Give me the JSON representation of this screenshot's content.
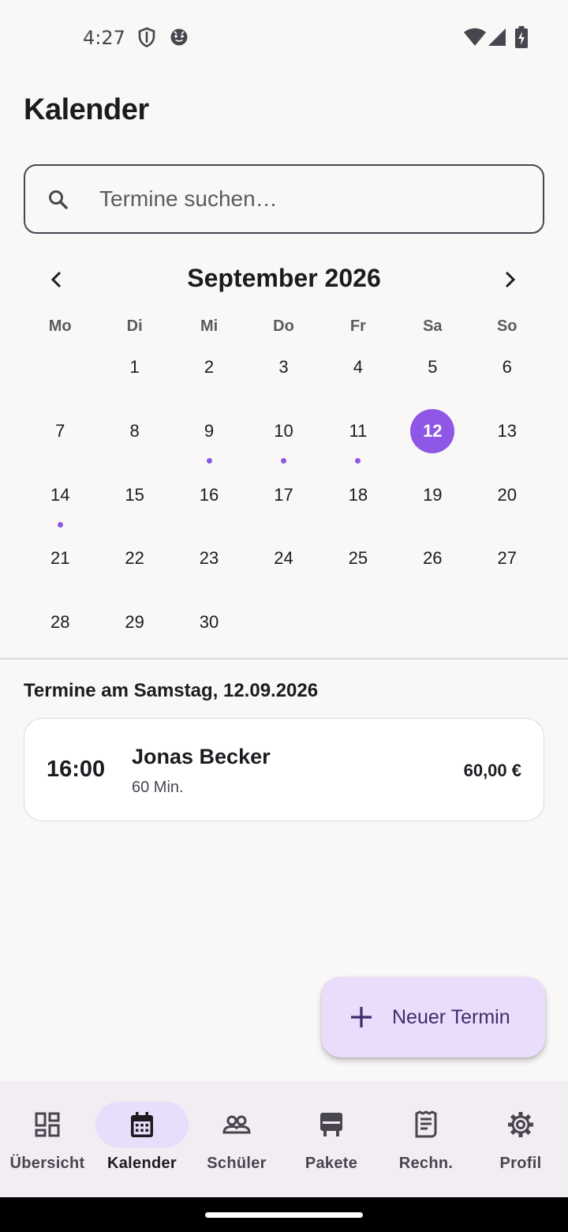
{
  "status_bar": {
    "time": "4:27"
  },
  "header": {
    "title": "Kalender"
  },
  "search": {
    "placeholder": "Termine suchen…",
    "value": ""
  },
  "calendar": {
    "month_label": "September 2026",
    "weekdays": [
      "Mo",
      "Di",
      "Mi",
      "Do",
      "Fr",
      "Sa",
      "So"
    ],
    "weeks": [
      [
        {
          "day": ""
        },
        {
          "day": "1"
        },
        {
          "day": "2"
        },
        {
          "day": "3"
        },
        {
          "day": "4"
        },
        {
          "day": "5"
        },
        {
          "day": "6"
        }
      ],
      [
        {
          "day": "7"
        },
        {
          "day": "8"
        },
        {
          "day": "9",
          "has_event": true
        },
        {
          "day": "10",
          "has_event": true
        },
        {
          "day": "11",
          "has_event": true
        },
        {
          "day": "12",
          "selected": true
        },
        {
          "day": "13"
        }
      ],
      [
        {
          "day": "14",
          "has_event": true
        },
        {
          "day": "15"
        },
        {
          "day": "16"
        },
        {
          "day": "17"
        },
        {
          "day": "18"
        },
        {
          "day": "19"
        },
        {
          "day": "20"
        }
      ],
      [
        {
          "day": "21"
        },
        {
          "day": "22"
        },
        {
          "day": "23"
        },
        {
          "day": "24"
        },
        {
          "day": "25"
        },
        {
          "day": "26"
        },
        {
          "day": "27"
        }
      ],
      [
        {
          "day": "28"
        },
        {
          "day": "29"
        },
        {
          "day": "30"
        },
        {
          "day": ""
        },
        {
          "day": ""
        },
        {
          "day": ""
        },
        {
          "day": ""
        }
      ]
    ]
  },
  "appointments": {
    "heading": "Termine am Samstag, 12.09.2026",
    "items": [
      {
        "time": "16:00",
        "name": "Jonas Becker",
        "duration": "60 Min.",
        "price": "60,00 €"
      }
    ]
  },
  "fab": {
    "label": "Neuer Termin",
    "icon": "plus-icon"
  },
  "bottom_nav": {
    "items": [
      {
        "label": "Übersicht",
        "icon": "dashboard-icon",
        "active": false
      },
      {
        "label": "Kalender",
        "icon": "calendar-icon",
        "active": true
      },
      {
        "label": "Schüler",
        "icon": "people-icon",
        "active": false
      },
      {
        "label": "Pakete",
        "icon": "package-icon",
        "active": false
      },
      {
        "label": "Rechn.",
        "icon": "receipt-icon",
        "active": false
      },
      {
        "label": "Profil",
        "icon": "gear-icon",
        "active": false
      }
    ]
  },
  "colors": {
    "accent": "#8e57e6",
    "fab_background": "#eadcfb",
    "nav_active_pill": "#e8ddfb",
    "background": "#f9f8f6"
  }
}
